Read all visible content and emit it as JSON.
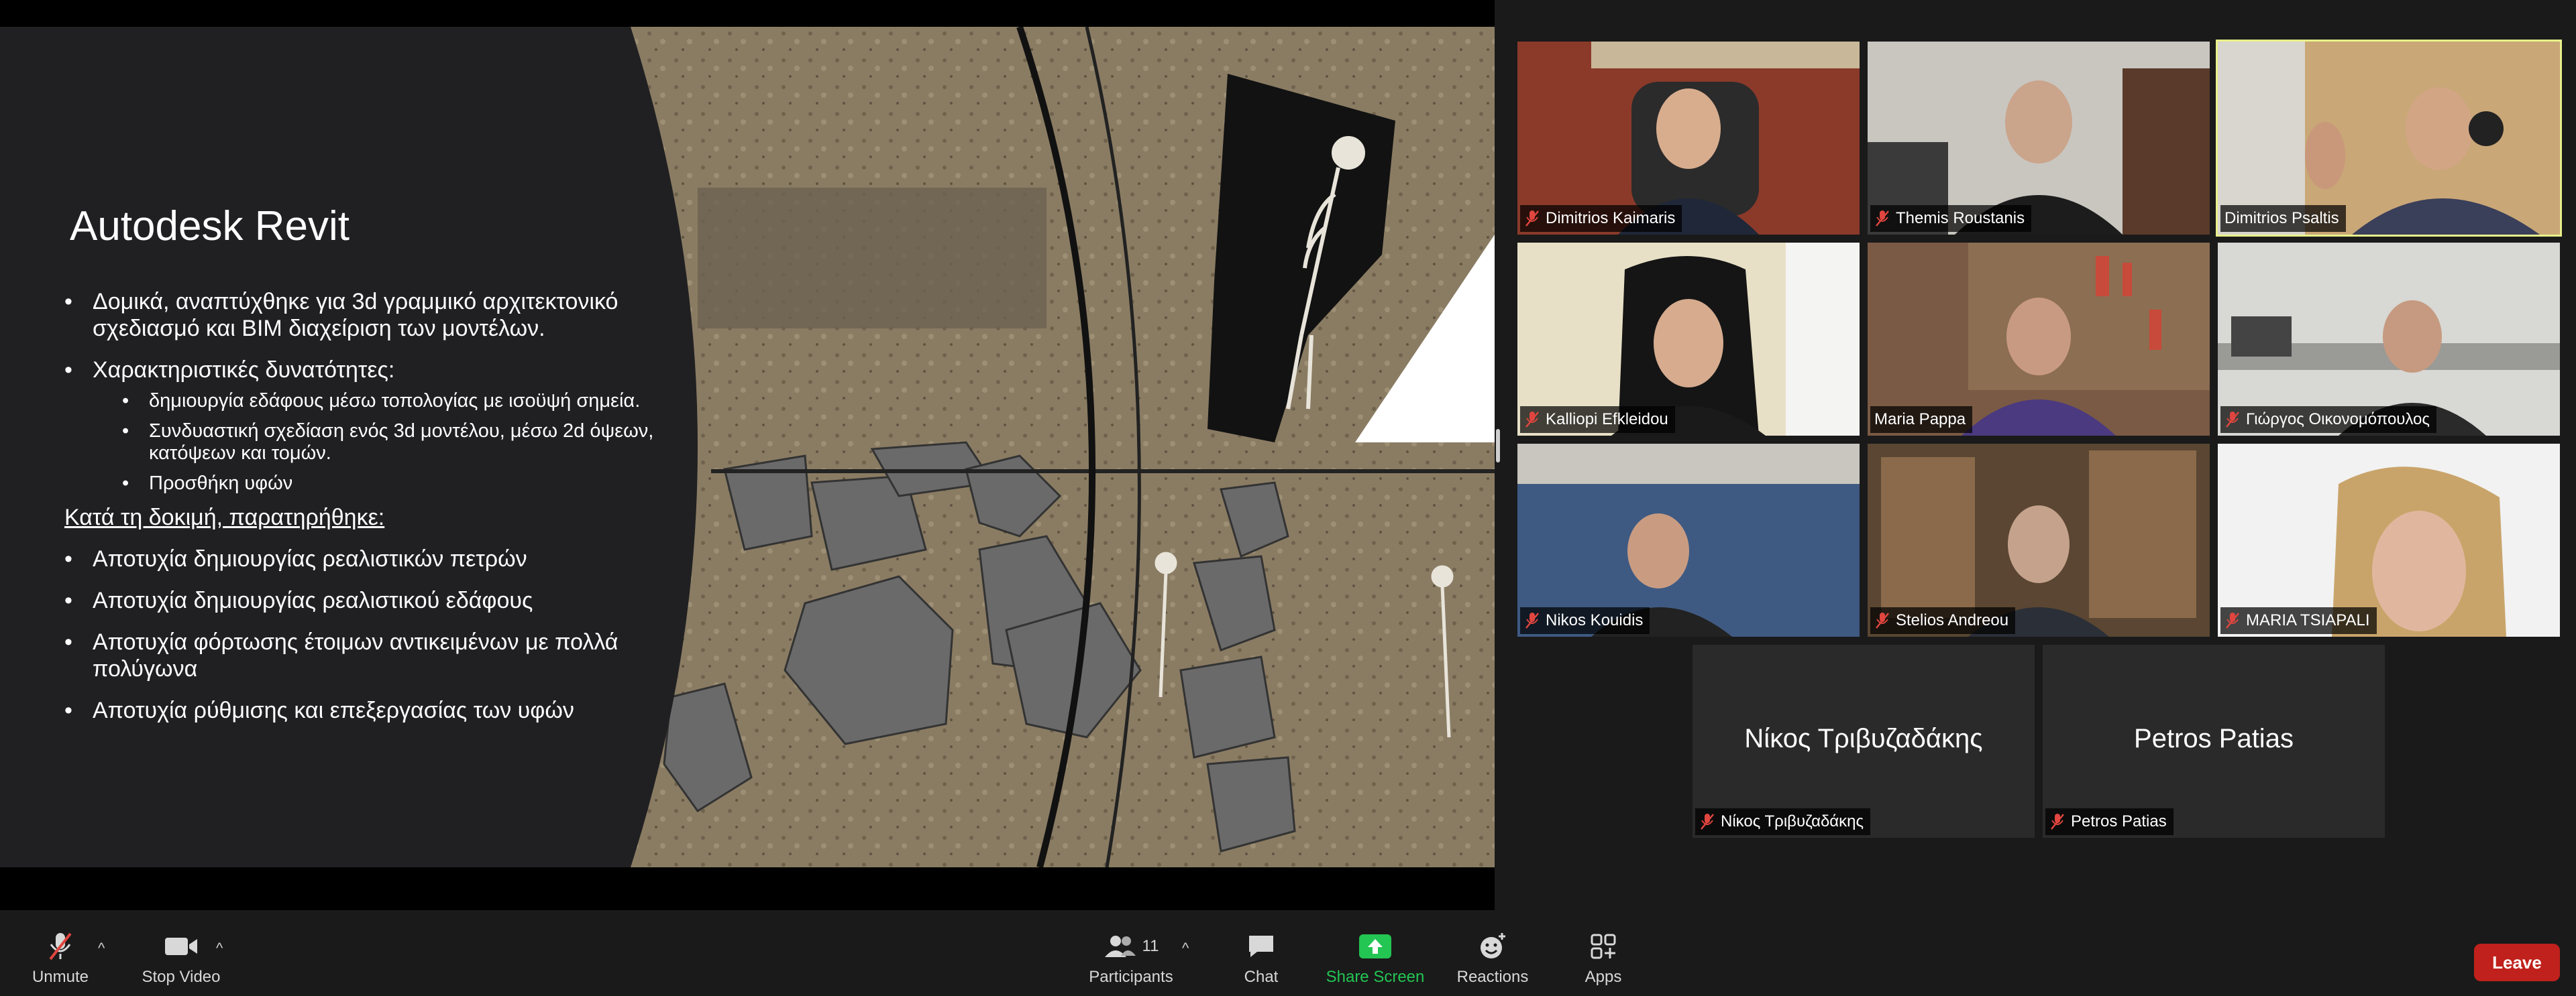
{
  "slide": {
    "title": "Autodesk Revit",
    "bullets": {
      "b1": "Δομικά, αναπτύχθηκε για 3d γραμμικό αρχιτεκτονικό σχεδιασμό και BIM διαχείριση των μοντέλων.",
      "b2": "Χαρακτηριστικές δυνατότητες:",
      "b2_1": "δημιουργία εδάφους μέσω τοπολογίας με ισοϋψή σημεία.",
      "b2_2": "Συνδυαστική σχεδίαση ενός 3d μοντέλου, μέσω 2d όψεων, κατόψεων και τομών.",
      "b2_3": "Προσθήκη υφών",
      "subhead": "Κατά τη δοκιμή, παρατηρήθηκε:",
      "f1": "Αποτυχία δημιουργίας ρεαλιστικών πετρών",
      "f2": "Αποτυχία δημιουργίας ρεαλιστικού εδάφους",
      "f3": "Αποτυχία φόρτωσης έτοιμων αντικειμένων με πολλά πολύγωνα",
      "f4": "Αποτυχία ρύθμισης και επεξεργασίας των υφών"
    }
  },
  "participants": {
    "p1": "Dimitrios Kaimaris",
    "p2": "Themis Roustanis",
    "p3": "Dimitrios Psaltis",
    "p4": "Kalliopi Efkleidou",
    "p5": "Maria Pappa",
    "p6": "Γιώργος Οικονομόπουλος",
    "p7": "Nikos Kouidis",
    "p8": "Stelios Andreou",
    "p9": "MARIA TSIAPALI",
    "p10": "Νίκος Τριβυζαδάκης",
    "p11": "Petros Patias"
  },
  "toolbar": {
    "unmute": "Unmute",
    "stop_video": "Stop Video",
    "participants": "Participants",
    "participant_count": "11",
    "chat": "Chat",
    "share_screen": "Share Screen",
    "reactions": "Reactions",
    "apps": "Apps",
    "leave": "Leave"
  },
  "colors": {
    "active_speaker": "#e8f08a",
    "share_green": "#23c553",
    "leave_red": "#c0211c",
    "muted_red": "#e0463f"
  }
}
